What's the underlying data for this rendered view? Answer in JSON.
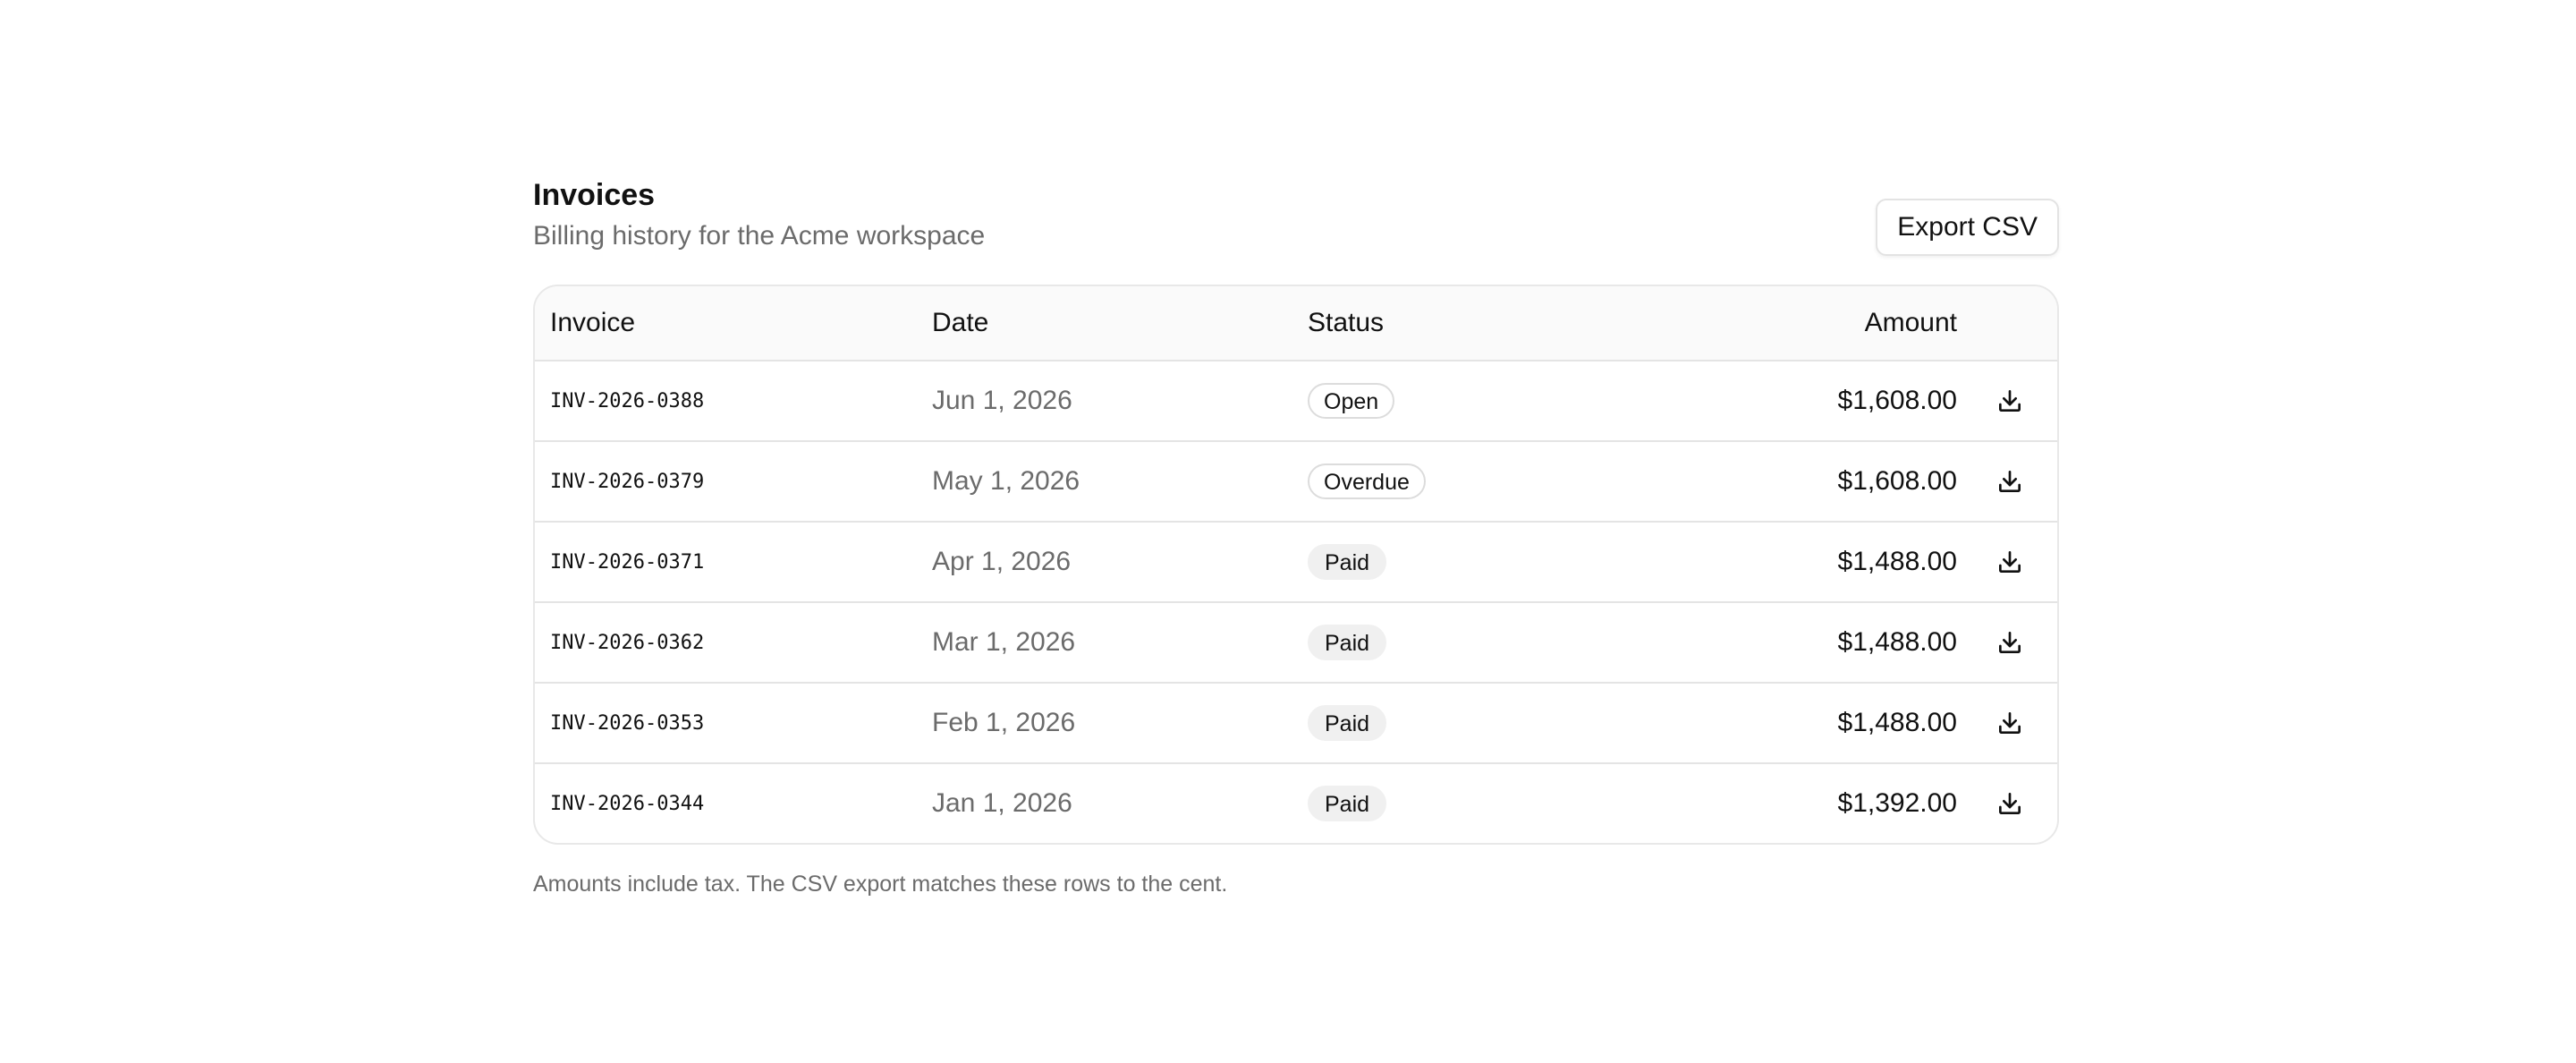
{
  "header": {
    "title": "Invoices",
    "subtitle": "Billing history for the Acme workspace",
    "export_label": "Export CSV"
  },
  "table": {
    "columns": {
      "invoice": "Invoice",
      "date": "Date",
      "status": "Status",
      "amount": "Amount"
    },
    "rows": [
      {
        "id": "INV-2026-0388",
        "date": "Jun 1, 2026",
        "status": "Open",
        "status_style": "outline",
        "amount": "$1,608.00",
        "action_icon": "download-icon"
      },
      {
        "id": "INV-2026-0379",
        "date": "May 1, 2026",
        "status": "Overdue",
        "status_style": "outline",
        "amount": "$1,608.00",
        "action_icon": "download-icon"
      },
      {
        "id": "INV-2026-0371",
        "date": "Apr 1, 2026",
        "status": "Paid",
        "status_style": "filled",
        "amount": "$1,488.00",
        "action_icon": "download-icon"
      },
      {
        "id": "INV-2026-0362",
        "date": "Mar 1, 2026",
        "status": "Paid",
        "status_style": "filled",
        "amount": "$1,488.00",
        "action_icon": "download-icon"
      },
      {
        "id": "INV-2026-0353",
        "date": "Feb 1, 2026",
        "status": "Paid",
        "status_style": "filled",
        "amount": "$1,488.00",
        "action_icon": "download-icon"
      },
      {
        "id": "INV-2026-0344",
        "date": "Jan 1, 2026",
        "status": "Paid",
        "status_style": "filled",
        "amount": "$1,392.00",
        "action_icon": "download-icon"
      }
    ]
  },
  "footnote": "Amounts include tax. The CSV export matches these rows to the cent.",
  "colors": {
    "text": "#111111",
    "muted": "#6b6b6b",
    "border": "#e4e4e4",
    "header_bg": "#fafafa",
    "badge_filled_bg": "#f0f0f0"
  }
}
